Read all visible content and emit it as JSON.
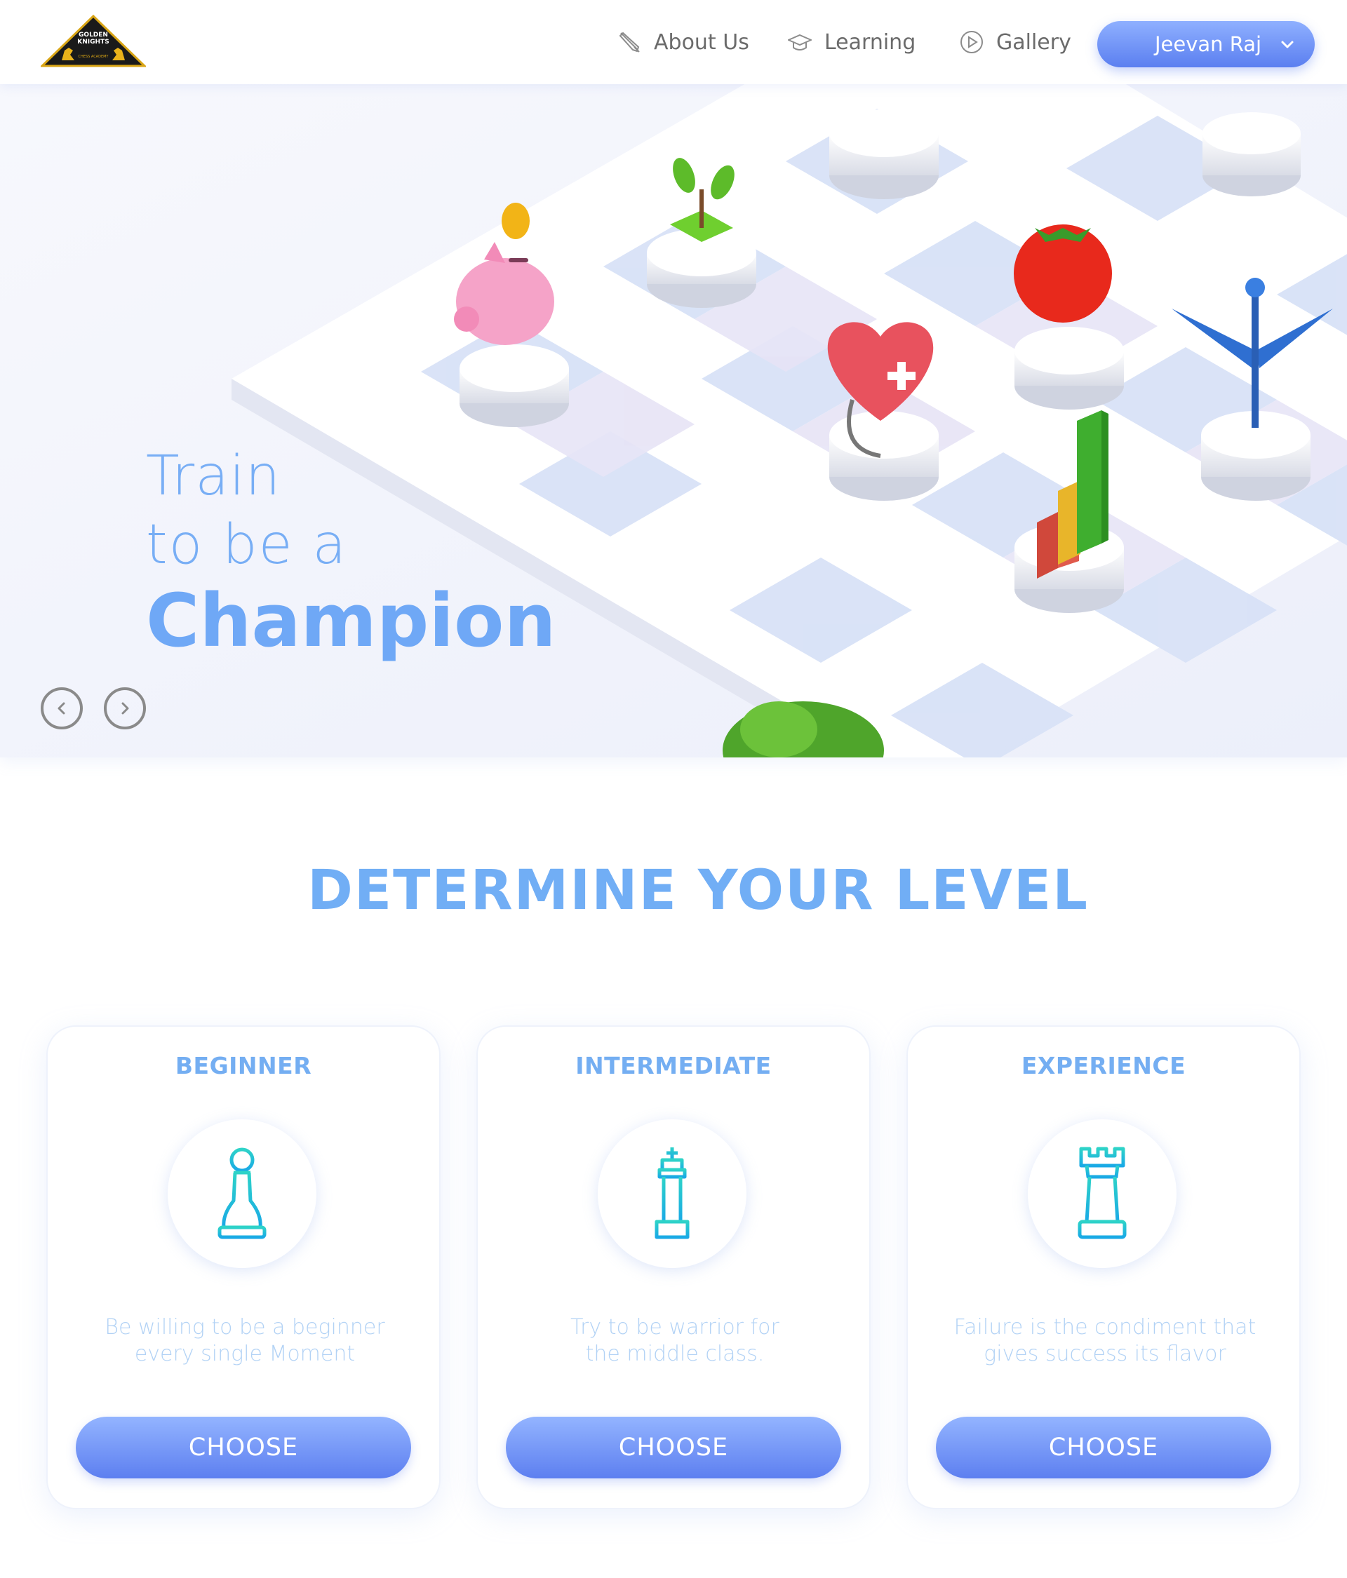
{
  "header": {
    "logo_text": "GOLDEN KNIGHTS",
    "nav": [
      {
        "label": "About Us",
        "icon": "quill-icon"
      },
      {
        "label": "Learning",
        "icon": "graduation-cap-icon"
      },
      {
        "label": "Gallery",
        "icon": "play-circle-icon"
      }
    ],
    "user": {
      "name": "Jeevan Raj",
      "icon": "chevron-down-icon"
    }
  },
  "hero": {
    "line1": "Train",
    "line2": "to be a",
    "line3": "Champion"
  },
  "section": {
    "title": "DETERMINE YOUR LEVEL"
  },
  "levels": [
    {
      "title": "BEGINNER",
      "icon": "chess-pawn-icon",
      "desc_line1": "Be willing to be a beginner",
      "desc_line2": "every single Moment",
      "button": "CHOOSE"
    },
    {
      "title": "INTERMEDIATE",
      "icon": "chess-king-icon",
      "desc_line1": "Try to be warrior for",
      "desc_line2": "the middle class.",
      "button": "CHOOSE"
    },
    {
      "title": "EXPERIENCE",
      "icon": "chess-rook-icon",
      "desc_line1": "Failure is the condiment that",
      "desc_line2": "gives success its flavor",
      "button": "CHOOSE"
    }
  ],
  "colors": {
    "accent": "#6fa8f6",
    "button_top": "#93b4ff",
    "button_bottom": "#5d7ff0",
    "icon_teal": "#1ec8dc"
  }
}
